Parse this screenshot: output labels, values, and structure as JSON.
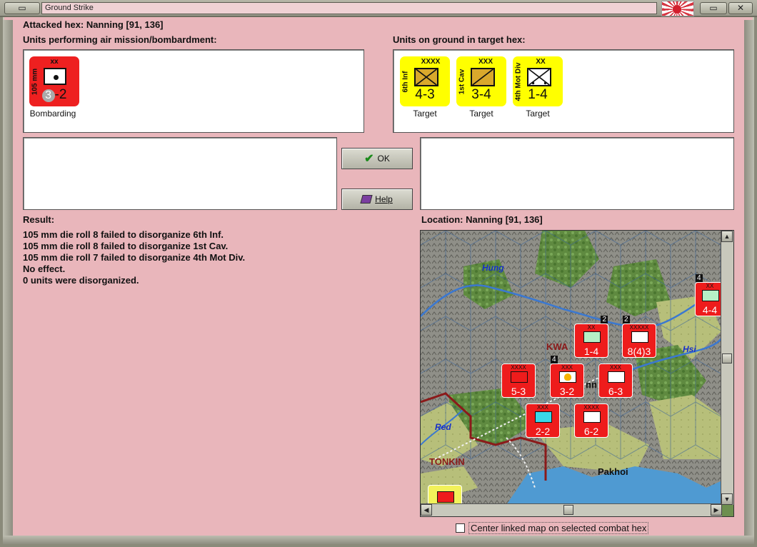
{
  "window": {
    "title": "Ground Strike"
  },
  "header": {
    "attacked_hex": "Attacked hex: Nanning  [91, 136]"
  },
  "air_units": {
    "heading": "Units performing air mission/bombardment:",
    "items": [
      {
        "name": "105 mm",
        "size": "xx",
        "strength_left": "3",
        "strength_sep": "-",
        "strength_right": "2",
        "caption": "Bombarding",
        "color": "#ee2020"
      }
    ]
  },
  "ground_units": {
    "heading": "Units on ground in target hex:",
    "items": [
      {
        "name": "6th Inf",
        "size": "XXXX",
        "strength": "4-3",
        "caption": "Target",
        "color": "#ffff00"
      },
      {
        "name": "1st Cav",
        "size": "XXX",
        "strength": "3-4",
        "caption": "Target",
        "color": "#ffff00"
      },
      {
        "name": "4th Mot Div",
        "size": "XX",
        "strength": "1-4",
        "caption": "Target",
        "color": "#ffff00"
      }
    ]
  },
  "buttons": {
    "ok": "OK",
    "help": "Help"
  },
  "result": {
    "heading": "Result:",
    "lines": [
      "105 mm die roll 8 failed to disorganize 6th Inf.",
      "105 mm die roll 8 failed to disorganize 1st Cav.",
      "105 mm die roll 7 failed to disorganize 4th Mot Div.",
      "No effect.",
      "0 units were disorganized."
    ]
  },
  "location": {
    "heading": "Location:  Nanning  [91, 136]",
    "map_labels": {
      "river_hung": "Hung",
      "river_hsi": "Hsi",
      "river_red": "Red",
      "region_kwa": "KWA",
      "region_tonkin": "TONKIN",
      "city_pakhoi": "Pakhoi",
      "city_nn": "nn"
    },
    "map_units": [
      {
        "strength": "1-4",
        "size": "XX",
        "stack": "2",
        "color": "#ee1c1c"
      },
      {
        "strength": "8(4)3",
        "size": "XXXXX",
        "stack": "2",
        "color": "#ee1c1c"
      },
      {
        "strength": "4-4",
        "size": "XX",
        "stack": "4",
        "color": "#ee1c1c"
      },
      {
        "strength": "5-3",
        "size": "XXXX",
        "stack": "",
        "color": "#ee1c1c"
      },
      {
        "strength": "3-2",
        "size": "XXX",
        "stack": "4",
        "color": "#ee1c1c"
      },
      {
        "strength": "6-3",
        "size": "XXX",
        "stack": "",
        "color": "#ee1c1c"
      },
      {
        "strength": "2-2",
        "size": "XXX",
        "stack": "",
        "color": "#ee1c1c"
      },
      {
        "strength": "6-2",
        "size": "XXXX",
        "stack": "",
        "color": "#ee1c1c"
      }
    ]
  },
  "footer": {
    "center_map_label": "Center linked map on selected combat hex"
  }
}
